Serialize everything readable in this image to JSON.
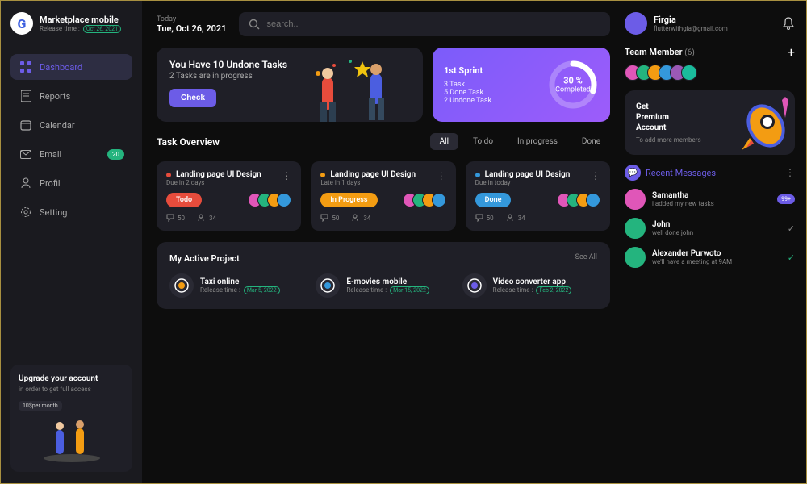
{
  "brand": {
    "title": "Marketplace mobile",
    "release_label": "Release time :",
    "release_date": "Oct 26, 2021"
  },
  "sidebar": {
    "items": [
      {
        "label": "Dashboard"
      },
      {
        "label": "Reports"
      },
      {
        "label": "Calendar"
      },
      {
        "label": "Email",
        "badge": "20"
      },
      {
        "label": "Profil"
      },
      {
        "label": "Setting"
      }
    ]
  },
  "upgrade": {
    "title": "Upgrade your account",
    "sub": "in order to get full access",
    "price": "10$per month"
  },
  "date": {
    "today": "Today",
    "value": "Tue, Oct 26, 2021"
  },
  "search": {
    "placeholder": "search.."
  },
  "hero": {
    "title": "You Have 10 Undone Tasks",
    "sub": "2 Tasks are in progress",
    "button": "Check"
  },
  "sprint": {
    "title": "1st Sprint",
    "lines": [
      "3 Task",
      "5 Done Task",
      "2 Undone Task"
    ],
    "percent": 30,
    "percent_label": "30 %",
    "completed": "Completed"
  },
  "overview": {
    "title": "Task Overview",
    "tabs": [
      "All",
      "To do",
      "In progress",
      "Done"
    ]
  },
  "tasks": [
    {
      "name": "Landing page UI Design",
      "due": "Due in 2 days",
      "status": "Todo",
      "color": "#e74c3c",
      "pill": "#e74c3c",
      "comments": "50",
      "members": "34"
    },
    {
      "name": "Landing page UI Design",
      "due": "Late in 1 days",
      "status": "In Progress",
      "color": "#f39c12",
      "pill": "#f39c12",
      "comments": "50",
      "members": "34"
    },
    {
      "name": "Landing page UI Design",
      "due": "Due in today",
      "status": "Done",
      "color": "#3498db",
      "pill": "#3498db",
      "comments": "50",
      "members": "34"
    }
  ],
  "projects": {
    "title": "My Active Project",
    "see_all": "See All",
    "items": [
      {
        "name": "Taxi online",
        "release_label": "Release time :",
        "date": "Mar 5, 2022"
      },
      {
        "name": "E-movies mobile",
        "release_label": "Release time :",
        "date": "Mar 15, 2022"
      },
      {
        "name": "Video converter app",
        "release_label": "Release time :",
        "date": "Feb 2, 2022"
      }
    ]
  },
  "user": {
    "name": "Firgia",
    "email": "flutterwithgia@gmail.com"
  },
  "team": {
    "title": "Team Member",
    "count": "(6)"
  },
  "premium": {
    "title_l1": "Get",
    "title_l2": "Premium",
    "title_l3": "Account",
    "sub": "To add more members"
  },
  "messages": {
    "title": "Recent Messages",
    "items": [
      {
        "name": "Samantha",
        "text": "i added my new tasks",
        "badge": "99+",
        "color": "#e056b8"
      },
      {
        "name": "John",
        "text": "well done john",
        "check": "grey",
        "color": "#24b47e"
      },
      {
        "name": "Alexander Purwoto",
        "text": "we'll have a meeting at 9AM",
        "check": "green",
        "color": "#24b47e"
      }
    ]
  },
  "avatar_colors": [
    "#e056b8",
    "#24b47e",
    "#f39c12",
    "#3498db",
    "#9b59b6",
    "#1abc9c"
  ]
}
